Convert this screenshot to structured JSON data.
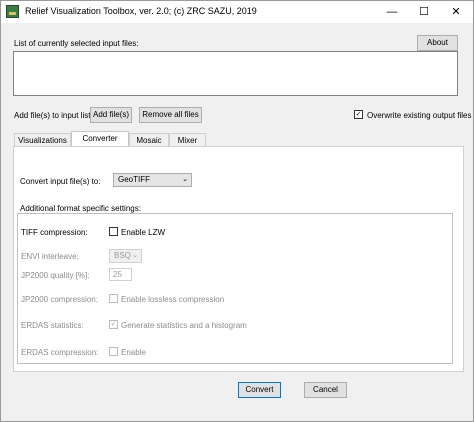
{
  "window": {
    "title": "Relief Visualization Toolbox, ver. 2.0; (c) ZRC SAZU, 2019"
  },
  "window_controls": {
    "minimize": "—",
    "maximize": "☐",
    "close": "✕"
  },
  "top": {
    "list_label": "List of currently selected input files:",
    "about_button": "About",
    "add_files_label": "Add file(s) to input list:",
    "add_files_button": "Add file(s)",
    "remove_all_button": "Remove all files",
    "overwrite_label": "Overwrite existing output files",
    "overwrite_checked": true
  },
  "tabs": [
    {
      "label": "Visualizations",
      "active": false
    },
    {
      "label": "Converter",
      "active": true
    },
    {
      "label": "Mosaic",
      "active": false
    },
    {
      "label": "Mixer",
      "active": false
    }
  ],
  "converter": {
    "convert_label": "Convert input file(s) to:",
    "format_value": "GeoTIFF",
    "format_settings_label": "Additional format specific settings:",
    "tiff_compression_label": "TIFF compression:",
    "enable_lzw_label": "Enable LZW",
    "envi_interleave_label": "ENVI interleave:",
    "envi_interleave_value": "BSQ",
    "jp2000_quality_label": "JP2000 quality [%]:",
    "jp2000_quality_value": "25",
    "jp2000_compression_label": "JP2000 compression:",
    "lossless_label": "Enable lossless compression",
    "erdas_statistics_label": "ERDAS statistics:",
    "generate_stats_label": "Generate statistics and a histogram",
    "erdas_compression_label": "ERDAS compression:",
    "enable_label": "Enable"
  },
  "bottom": {
    "convert_button": "Convert",
    "cancel_button": "Cancel"
  }
}
